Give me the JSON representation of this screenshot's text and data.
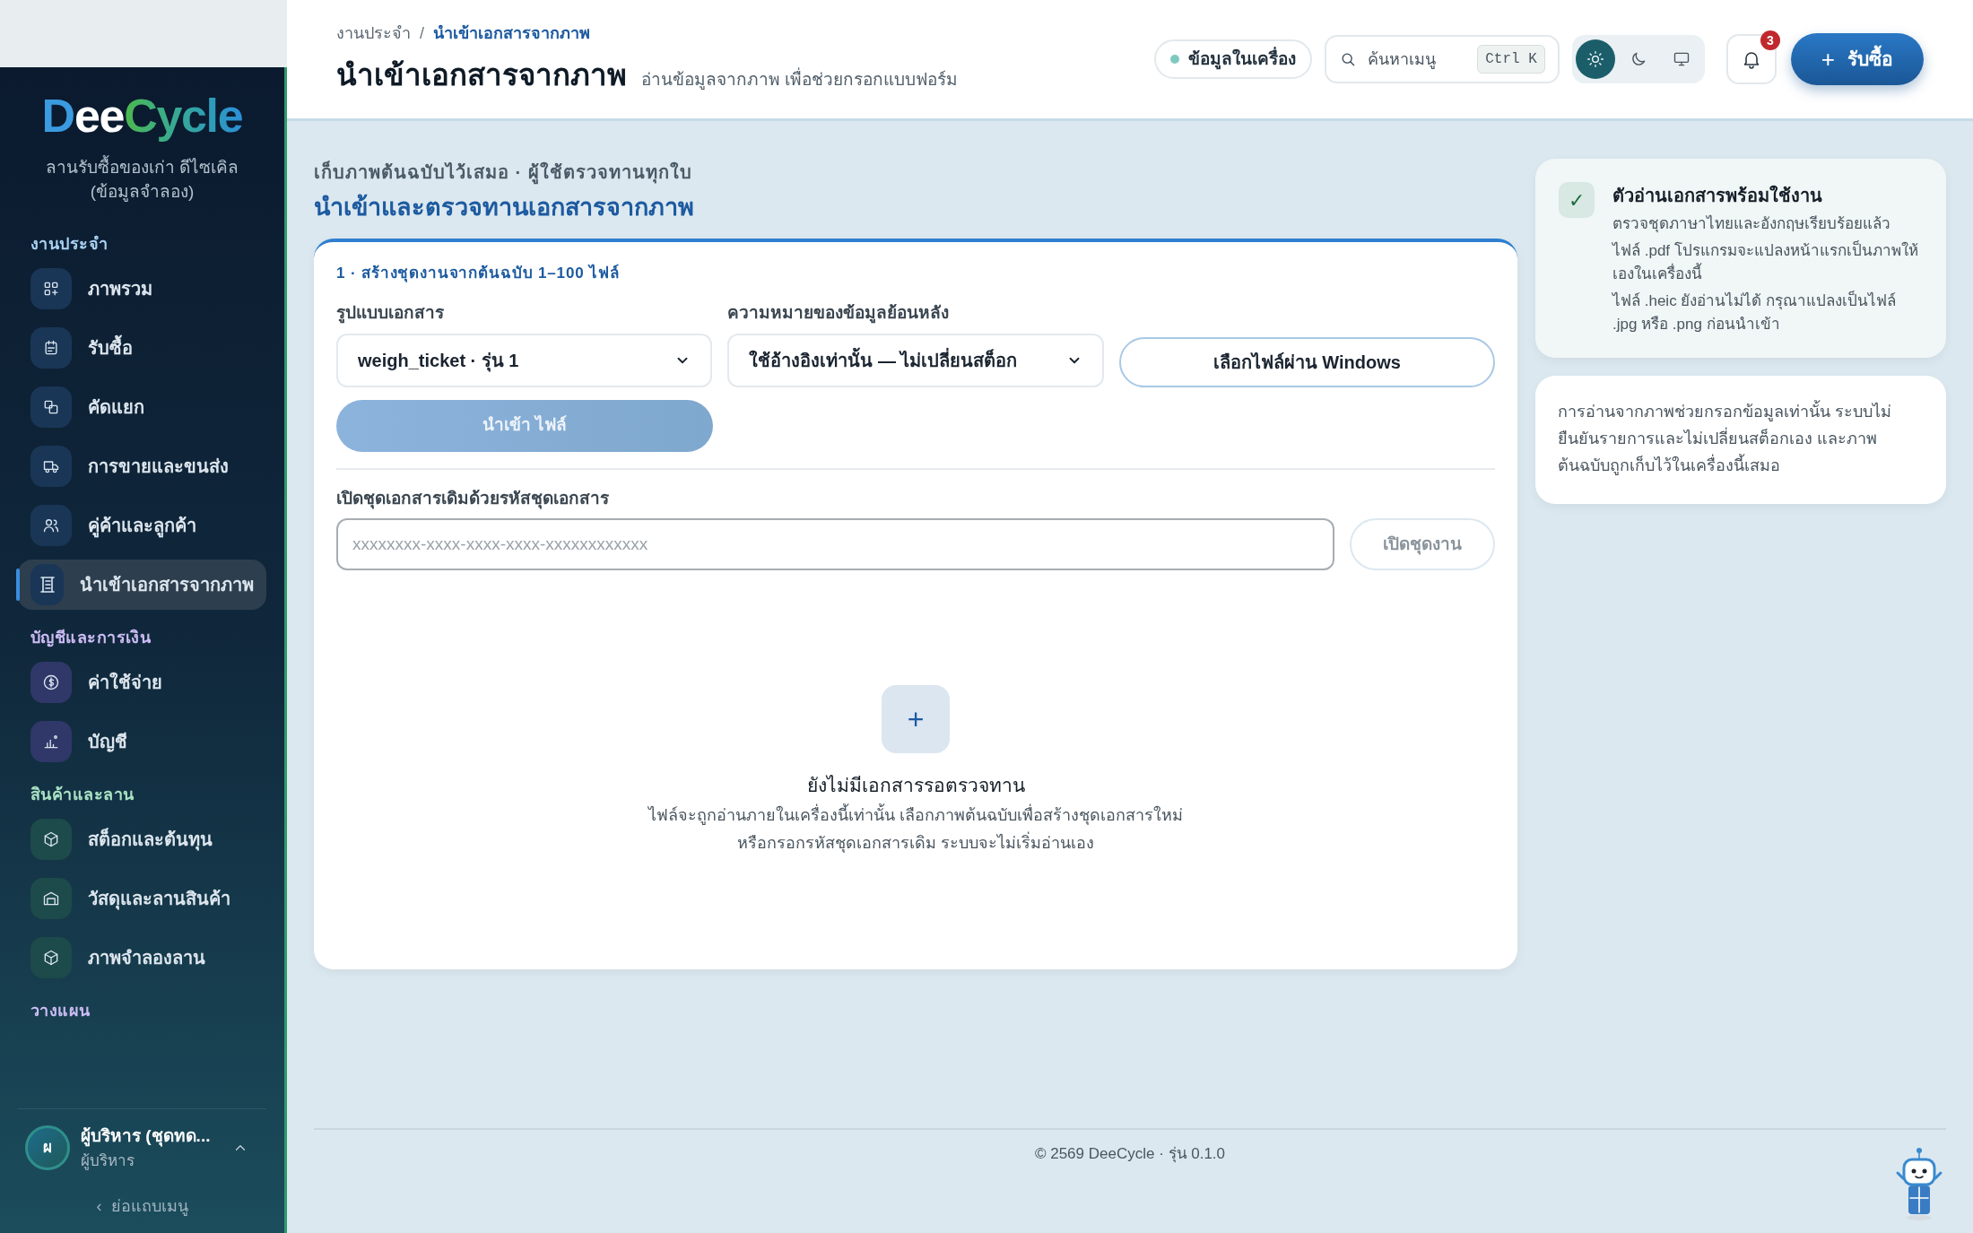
{
  "sidebar": {
    "logo": "DeeCycle",
    "org": "ลานรับซื้อของเก่า ดีไซเคิล (ข้อมูลจำลอง)",
    "sections": [
      {
        "label": "งานประจำ",
        "color": "#a9d2f3",
        "items": [
          {
            "label": "ภาพรวม",
            "selected": false
          },
          {
            "label": "รับซื้อ",
            "selected": false
          },
          {
            "label": "คัดแยก",
            "selected": false
          },
          {
            "label": "การขายและขนส่ง",
            "selected": false
          },
          {
            "label": "คู่ค้าและลูกค้า",
            "selected": false
          },
          {
            "label": "นำเข้าเอกสารจากภาพ",
            "selected": true
          }
        ]
      },
      {
        "label": "บัญชีและการเงิน",
        "color": "#cdbcf5",
        "items": [
          {
            "label": "ค่าใช้จ่าย",
            "selected": false
          },
          {
            "label": "บัญชี",
            "selected": false
          }
        ]
      },
      {
        "label": "สินค้าและลาน",
        "color": "#a9e3c4",
        "items": [
          {
            "label": "สต็อกและต้นทุน",
            "selected": false
          },
          {
            "label": "วัสดุและลานสินค้า",
            "selected": false
          },
          {
            "label": "ภาพจำลองลาน",
            "selected": false
          }
        ]
      },
      {
        "label": "วางแผน",
        "color": "#cdbcf5"
      }
    ],
    "user": {
      "initial": "ผ",
      "name": "ผู้บริหาร (ชุดทด...",
      "role": "ผู้บริหาร"
    },
    "collapse": {
      "glyph": "‹",
      "label": "ย่อแถบเมนู"
    }
  },
  "header": {
    "breadcrumb": [
      "งานประจำ",
      "นำเข้าเอกสารจากภาพ"
    ],
    "breadcrumb_separator": "/",
    "title": "นำเข้าเอกสารจากภาพ",
    "subtitle": "อ่านข้อมูลจากภาพ เพื่อช่วยกรอกแบบฟอร์ม",
    "status": "ข้อมูลในเครื่อง",
    "search": {
      "placeholder": "ค้นหาเมนู",
      "shortcut": "Ctrl K"
    },
    "themes": [
      {
        "selected": true
      },
      {
        "selected": false
      },
      {
        "selected": false
      }
    ],
    "notifications": "3",
    "primary_button": {
      "glyph": "+",
      "label": "รับซื้อ"
    }
  },
  "main": {
    "eyebrow": "เก็บภาพต้นฉบับไว้เสมอ · ผู้ใช้ตรวจทานทุกใบ",
    "heading": "นำเข้าและตรวจทานเอกสารจากภาพ",
    "step": "1 · สร้างชุดงานจากต้นฉบับ 1–100 ไฟล์",
    "fields": [
      {
        "label": "รูปแบบเอกสาร",
        "value": "weigh_ticket · รุ่น 1"
      },
      {
        "label": "ความหมายของข้อมูลย้อนหลัง",
        "value": "ใช้อ้างอิงเท่านั้น — ไม่เปลี่ยนสต็อก"
      }
    ],
    "choose_button": "เลือกไฟล์ผ่าน Windows",
    "import_button": {
      "label": "นำเข้า ไฟล์",
      "disabled": true
    },
    "open_label": "เปิดชุดเอกสารเดิมด้วยรหัสชุดเอกสาร",
    "open_input": {
      "placeholder": "xxxxxxxx-xxxx-xxxx-xxxx-xxxxxxxxxxxx"
    },
    "open_button": {
      "label": "เปิดชุดงาน",
      "disabled": true
    },
    "empty": {
      "glyph": "+",
      "title": "ยังไม่มีเอกสารรอตรวจทาน",
      "lines": [
        "ไฟล์จะถูกอ่านภายในเครื่องนี้เท่านั้น เลือกภาพต้นฉบับเพื่อสร้างชุดเอกสารใหม่",
        "หรือกรอกรหัสชุดเอกสารเดิม ระบบจะไม่เริ่มอ่านเอง"
      ]
    }
  },
  "aside": [
    {
      "kind": "status",
      "glyph": "✓",
      "title": "ตัวอ่านเอกสารพร้อมใช้งาน",
      "lines": [
        "ตรวจชุดภาษาไทยและอังกฤษเรียบร้อยแล้ว",
        "ไฟล์ .pdf โปรแกรมจะแปลงหน้าแรกเป็นภาพให้เองในเครื่องนี้",
        "ไฟล์ .heic ยังอ่านไม่ได้ กรุณาแปลงเป็นไฟล์ .jpg หรือ .png ก่อนนำเข้า"
      ]
    },
    {
      "kind": "note",
      "text": "การอ่านจากภาพช่วยกรอกข้อมูลเท่านั้น ระบบไม่ยืนยันรายการและไม่เปลี่ยนสต็อกเอง และภาพต้นฉบับถูกเก็บไว้ในเครื่องนี้เสมอ"
    }
  ],
  "footer": "© 2569 DeeCycle · รุ่น 0.1.0"
}
